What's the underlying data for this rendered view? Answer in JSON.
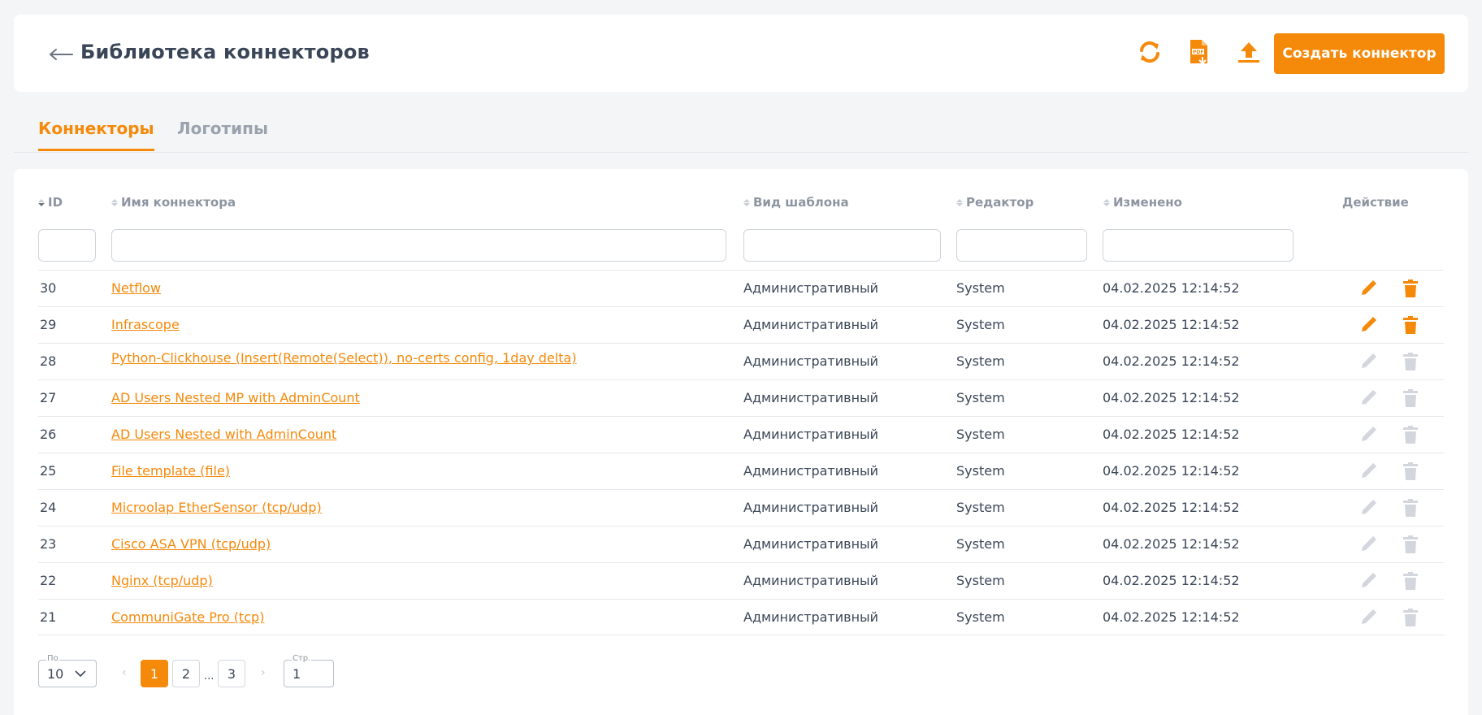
{
  "header": {
    "title": "Библиотека коннекторов",
    "create_label": "Создать коннектор",
    "icons": [
      "back-arrow-icon",
      "refresh-icon",
      "pdf-download-icon",
      "upload-icon"
    ]
  },
  "tabs": [
    {
      "label": "Коннекторы",
      "active": true
    },
    {
      "label": "Логотипы",
      "active": false
    }
  ],
  "table": {
    "columns": {
      "id": "ID",
      "name": "Имя коннектора",
      "template": "Вид шаблона",
      "editor": "Редактор",
      "modified": "Изменено",
      "action": "Действие"
    },
    "rows": [
      {
        "id": "30",
        "name": "Netflow",
        "template": "Административный",
        "editor": "System",
        "modified": "04.02.2025 12:14:52",
        "actions_enabled": true
      },
      {
        "id": "29",
        "name": "Infrascope",
        "template": "Административный",
        "editor": "System",
        "modified": "04.02.2025 12:14:52",
        "actions_enabled": true
      },
      {
        "id": "28",
        "name": "Python-Clickhouse (Insert(Remote(Select)), no-certs config, 1day delta)",
        "template": "Административный",
        "editor": "System",
        "modified": "04.02.2025 12:14:52",
        "actions_enabled": false
      },
      {
        "id": "27",
        "name": "AD Users Nested MP with AdminCount",
        "template": "Административный",
        "editor": "System",
        "modified": "04.02.2025 12:14:52",
        "actions_enabled": false
      },
      {
        "id": "26",
        "name": "AD Users Nested with AdminCount",
        "template": "Административный",
        "editor": "System",
        "modified": "04.02.2025 12:14:52",
        "actions_enabled": false
      },
      {
        "id": "25",
        "name": "File template (file)",
        "template": "Административный",
        "editor": "System",
        "modified": "04.02.2025 12:14:52",
        "actions_enabled": false
      },
      {
        "id": "24",
        "name": "Microolap EtherSensor (tcp/udp)",
        "template": "Административный",
        "editor": "System",
        "modified": "04.02.2025 12:14:52",
        "actions_enabled": false
      },
      {
        "id": "23",
        "name": "Cisco ASA VPN (tcp/udp)",
        "template": "Административный",
        "editor": "System",
        "modified": "04.02.2025 12:14:52",
        "actions_enabled": false
      },
      {
        "id": "22",
        "name": "Nginx (tcp/udp)",
        "template": "Административный",
        "editor": "System",
        "modified": "04.02.2025 12:14:52",
        "actions_enabled": false
      },
      {
        "id": "21",
        "name": "CommuniGate Pro (tcp)",
        "template": "Административный",
        "editor": "System",
        "modified": "04.02.2025 12:14:52",
        "actions_enabled": false
      }
    ]
  },
  "pagination": {
    "per_page_label": "По",
    "per_page_value": "10",
    "pages": [
      "1",
      "2",
      "3"
    ],
    "ellipsis": "...",
    "current_page": "1",
    "page_input_label": "Стр.",
    "page_input_value": "1"
  },
  "colors": {
    "accent": "#f5890a",
    "disabled_icon": "#d3d7dd"
  }
}
